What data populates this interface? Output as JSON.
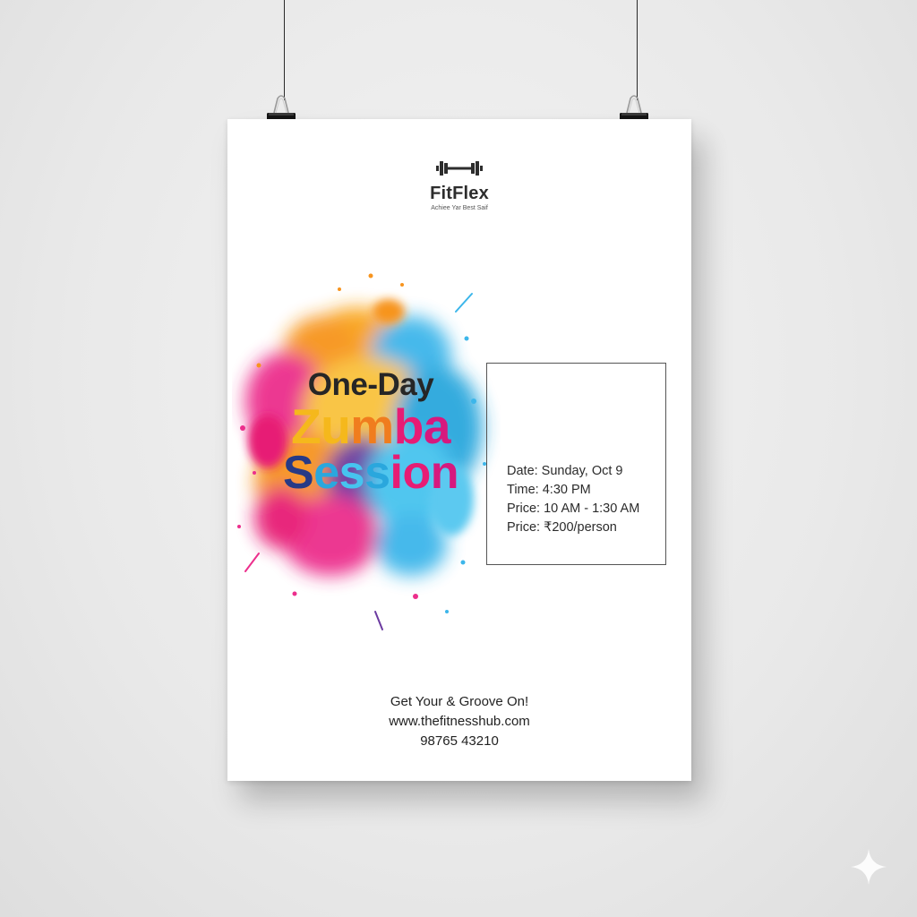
{
  "brand": {
    "name": "FitFlex",
    "tagline": "Achiee Yar Best Saif",
    "icon": "dumbbell-icon"
  },
  "headline": {
    "line1": "One-Day",
    "line2_letters": [
      {
        "ch": "Z",
        "color": "#f5b81c"
      },
      {
        "ch": "u",
        "color": "#f5b81c"
      },
      {
        "ch": "m",
        "color": "#f07d1e"
      },
      {
        "ch": "b",
        "color": "#e71c74"
      },
      {
        "ch": "a",
        "color": "#d6197e"
      }
    ],
    "line3_letters": [
      {
        "ch": "S",
        "color": "#273a86"
      },
      {
        "ch": "e",
        "color": "#2aa7dd"
      },
      {
        "ch": "s",
        "color": "#46c4ef"
      },
      {
        "ch": "s",
        "color": "#2aa7dd"
      },
      {
        "ch": "i",
        "color": "#e71c74"
      },
      {
        "ch": "o",
        "color": "#e71c74"
      },
      {
        "ch": "n",
        "color": "#d6197e"
      }
    ]
  },
  "details": {
    "date": "Date: Sunday, Oct 9",
    "time": "Time: 4:30 PM",
    "price_hours": "Price: 10 AM - 1:30 AM",
    "price": "Price: ₹200/person"
  },
  "footer": {
    "cta": "Get Your & Groove On!",
    "website": "www.thefitnesshub.com",
    "phone": "98765 43210"
  },
  "colors": {
    "poster_bg": "#ffffff",
    "wall_bg": "#e9e9e9",
    "text_dark": "#262626",
    "splash_pink": "#ec2e8c",
    "splash_orange": "#f7941e",
    "splash_blue": "#3cb6ea",
    "splash_yellow": "#f9c23c"
  }
}
